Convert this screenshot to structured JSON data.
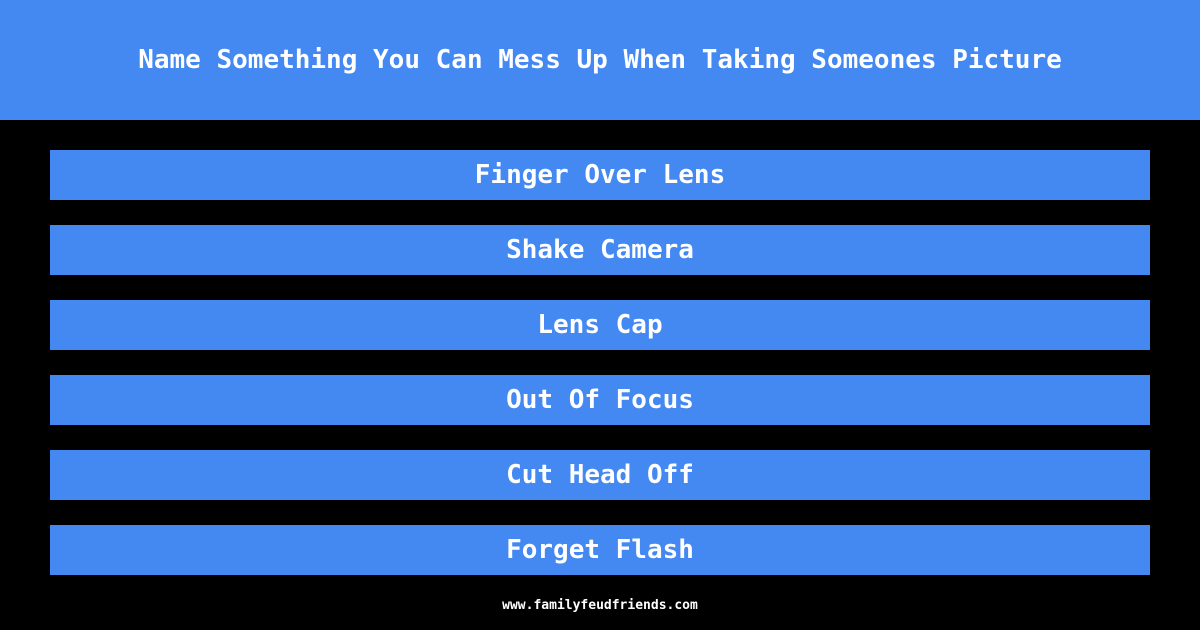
{
  "question": "Name Something You Can Mess Up When Taking Someones Picture",
  "answers": [
    {
      "label": "Finger Over Lens"
    },
    {
      "label": "Shake Camera"
    },
    {
      "label": "Lens Cap"
    },
    {
      "label": "Out Of Focus"
    },
    {
      "label": "Cut Head Off"
    },
    {
      "label": "Forget Flash"
    }
  ],
  "footer": "www.familyfeudfriends.com",
  "colors": {
    "accent": "#4488f2",
    "background": "#000000",
    "text": "#ffffff"
  }
}
